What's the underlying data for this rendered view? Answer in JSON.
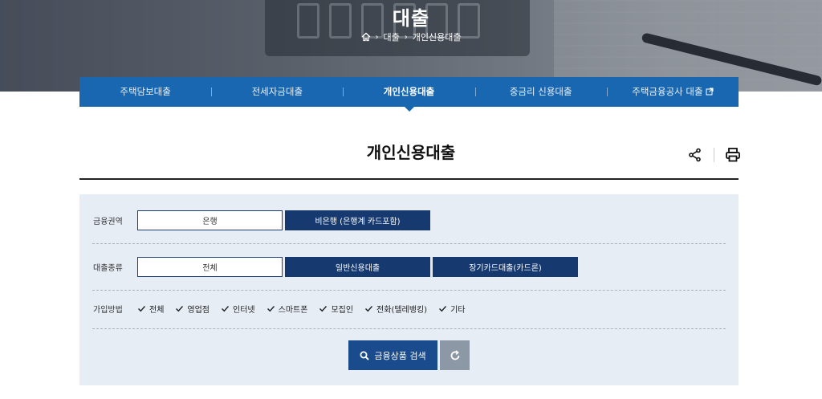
{
  "hero": {
    "title": "대출",
    "breadcrumb": [
      "대출",
      "개인신용대출"
    ],
    "home_icon": "home-icon"
  },
  "tabs": [
    {
      "label": "주택담보대출",
      "active": false
    },
    {
      "label": "전세자금대출",
      "active": false
    },
    {
      "label": "개인신용대출",
      "active": true
    },
    {
      "label": "중금리 신용대출",
      "active": false
    },
    {
      "label": "주택금융공사 대출",
      "active": false,
      "icon": "external-link-icon"
    }
  ],
  "page": {
    "title": "개인신용대출",
    "share_icon": "share-icon",
    "print_icon": "print-icon"
  },
  "filters": {
    "sector": {
      "label": "금융권역",
      "options": [
        {
          "label": "은행",
          "selected": false
        },
        {
          "label": "비은행 (은행계 카드포함)",
          "selected": true
        }
      ]
    },
    "loan_type": {
      "label": "대출종류",
      "options": [
        {
          "label": "전체",
          "selected": false
        },
        {
          "label": "일반신용대출",
          "selected": true
        },
        {
          "label": "장기카드대출(카드론)",
          "selected": true
        }
      ]
    },
    "join_method": {
      "label": "가입방법",
      "options": [
        {
          "label": "전체",
          "checked": true
        },
        {
          "label": "영업점",
          "checked": true
        },
        {
          "label": "인터넷",
          "checked": true
        },
        {
          "label": "스마트폰",
          "checked": true
        },
        {
          "label": "모집인",
          "checked": true
        },
        {
          "label": "전화(텔레뱅킹)",
          "checked": true
        },
        {
          "label": "기타",
          "checked": true
        }
      ]
    }
  },
  "actions": {
    "search_label": "금융상품 검색",
    "search_icon": "search-icon",
    "reset_icon": "reset-icon"
  },
  "colors": {
    "tab_bar": "#1a67b1",
    "selected_option": "#163a70",
    "panel_bg": "#e7edf5",
    "search_button": "#1a4b8c",
    "reset_button": "#8d98a6"
  }
}
